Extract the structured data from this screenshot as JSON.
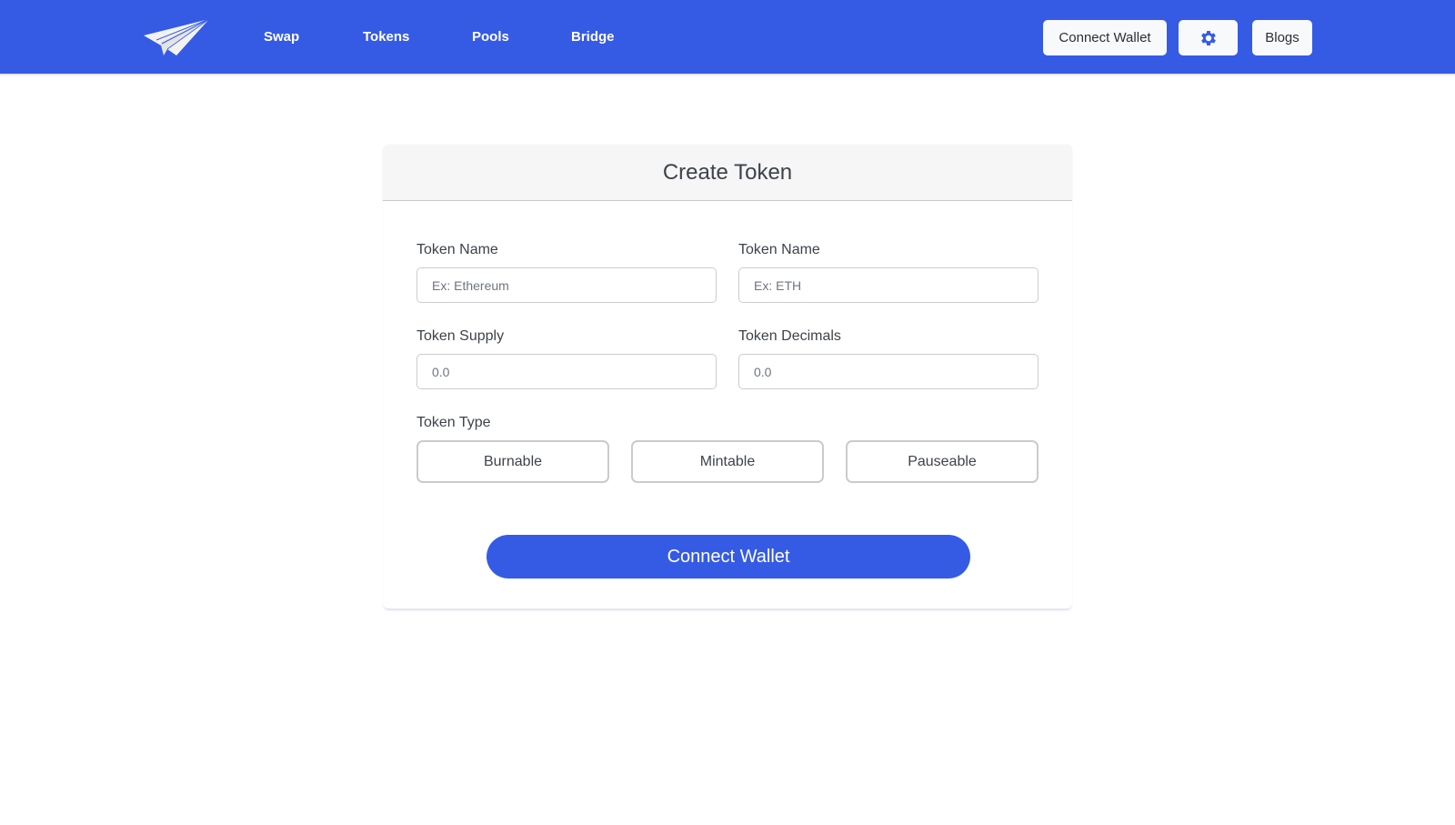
{
  "nav": {
    "logo": "paper-plane-logo",
    "links": [
      "Swap",
      "Tokens",
      "Pools",
      "Bridge"
    ],
    "connect_wallet": "Connect Wallet",
    "settings_icon": "gear-icon",
    "blogs": "Blogs"
  },
  "form": {
    "title": "Create Token",
    "fields": [
      {
        "label": "Token Name",
        "placeholder": "Ex: Ethereum",
        "value": ""
      },
      {
        "label": "Token Name",
        "placeholder": "Ex: ETH",
        "value": ""
      },
      {
        "label": "Token Supply",
        "placeholder": "0.0",
        "value": ""
      },
      {
        "label": "Token Decimals",
        "placeholder": "0.0",
        "value": ""
      }
    ],
    "token_type_label": "Token Type",
    "token_types": [
      "Burnable",
      "Mintable",
      "Pauseable"
    ],
    "submit": "Connect Wallet"
  },
  "colors": {
    "brand": "#355be5",
    "nav_button_bg": "#f8f9fb",
    "text": "#3d434b"
  }
}
